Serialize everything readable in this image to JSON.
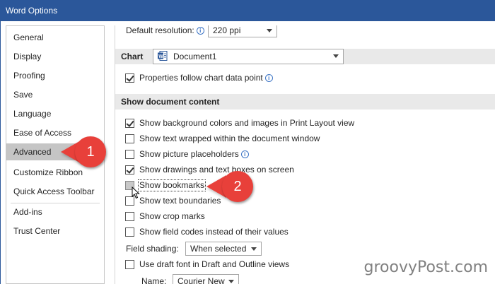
{
  "window": {
    "title": "Word Options"
  },
  "sidebar": {
    "items": [
      {
        "label": "General"
      },
      {
        "label": "Display"
      },
      {
        "label": "Proofing"
      },
      {
        "label": "Save"
      },
      {
        "label": "Language"
      },
      {
        "label": "Ease of Access"
      },
      {
        "label": "Advanced",
        "selected": true
      },
      {
        "label": "Customize Ribbon"
      },
      {
        "label": "Quick Access Toolbar"
      },
      {
        "label": "Add-ins"
      },
      {
        "label": "Trust Center"
      }
    ]
  },
  "image_size": {
    "default_resolution_label": "Default resolution:",
    "default_resolution_value": "220 ppi"
  },
  "chart": {
    "section_label": "Chart",
    "document_value": "Document1",
    "properties_follow_label": "Properties follow chart data point",
    "properties_follow_checked": true
  },
  "show_document_content": {
    "heading": "Show document content",
    "options": [
      {
        "label": "Show background colors and images in Print Layout view",
        "checked": true
      },
      {
        "label": "Show text wrapped within the document window",
        "checked": false
      },
      {
        "label": "Show picture placeholders",
        "checked": false,
        "info": true
      },
      {
        "label": "Show drawings and text boxes on screen",
        "checked": true
      },
      {
        "label": "Show bookmarks",
        "checked": false,
        "hover": true
      },
      {
        "label": "Show text boundaries",
        "checked": false
      },
      {
        "label": "Show crop marks",
        "checked": false
      },
      {
        "label": "Show field codes instead of their values",
        "checked": false
      }
    ],
    "field_shading_label": "Field shading:",
    "field_shading_value": "When selected",
    "draft_font_label": "Use draft font in Draft and Outline views",
    "draft_font_checked": false,
    "name_label": "Name:",
    "name_value": "Courier New"
  },
  "callouts": [
    {
      "number": "1"
    },
    {
      "number": "2"
    }
  ],
  "watermark": "groovyPost.com",
  "colors": {
    "titlebar": "#2b579a",
    "callout": "#e8403a",
    "selected_nav": "#c5c5c5",
    "section_bg": "#e9e9e9"
  }
}
